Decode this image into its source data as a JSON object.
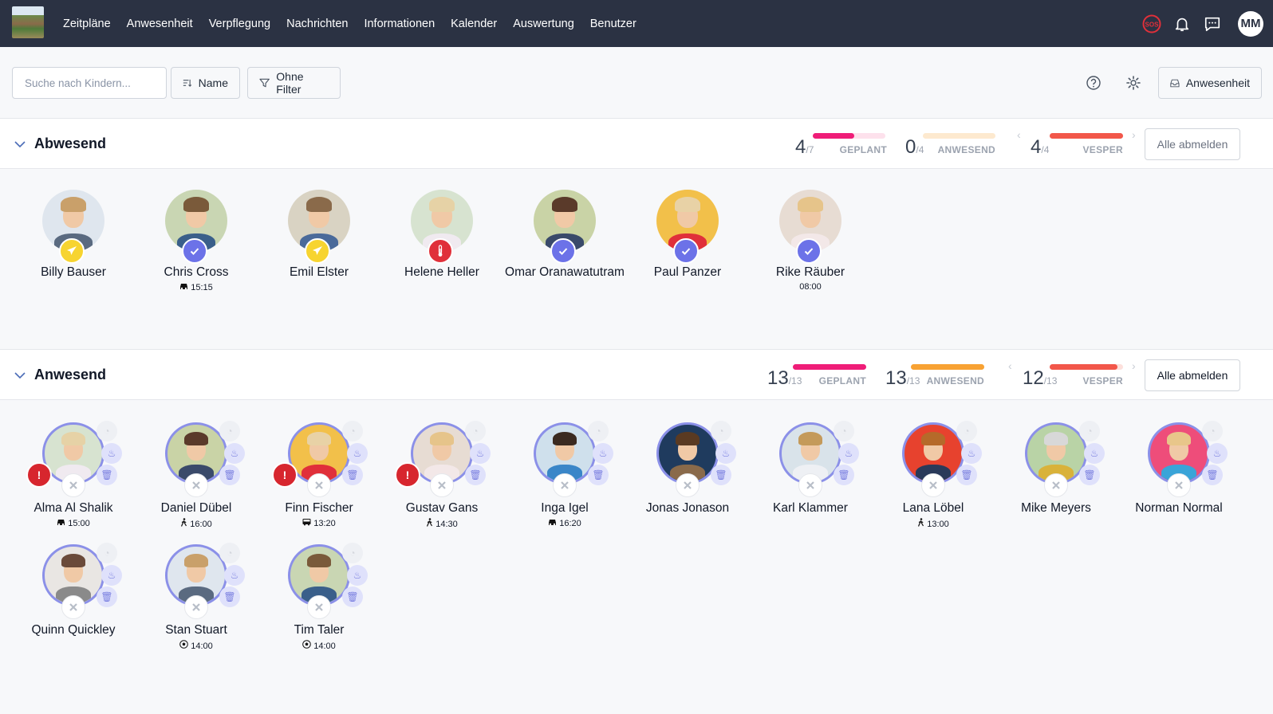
{
  "nav": {
    "items": [
      "Zeitpläne",
      "Anwesenheit",
      "Verpflegung",
      "Nachrichten",
      "Informationen",
      "Kalender",
      "Auswertung",
      "Benutzer"
    ],
    "sos_label": "SOS",
    "user_initials": "MM"
  },
  "toolbar": {
    "search_placeholder": "Suche nach Kindern...",
    "sort_label": "Name",
    "filter_label": "Ohne Filter",
    "attendance_label": "Anwesenheit"
  },
  "sections": [
    {
      "title": "Abwesend",
      "stats": {
        "geplant": {
          "value": "4",
          "total": "/7",
          "label": "GEPLANT",
          "fraction": 0.57,
          "color": "#ef1d78",
          "track": "#fde1ec"
        },
        "anwesend": {
          "value": "0",
          "total": "/4",
          "label": "ANWESEND",
          "fraction": 0,
          "color": "#f8a233",
          "track": "#fde9cf"
        },
        "vesper": {
          "value": "4",
          "total": "/4",
          "label": "VESPER",
          "fraction": 1,
          "color": "#f2574a",
          "track": "#fde0dc"
        }
      },
      "action_label": "Alle abmelden",
      "children": [
        {
          "name": "Billy Bauser",
          "sub": "",
          "status": "vacation"
        },
        {
          "name": "Chris Cross",
          "sub": "15:15",
          "sub_icon": "car",
          "status": "check"
        },
        {
          "name": "Emil Elster",
          "sub": "",
          "status": "vacation"
        },
        {
          "name": "Helene Heller",
          "sub": "",
          "status": "sick"
        },
        {
          "name": "Omar Oranawatutram",
          "sub": "",
          "status": "check"
        },
        {
          "name": "Paul Panzer",
          "sub": "",
          "status": "check"
        },
        {
          "name": "Rike Räuber",
          "sub": "08:00",
          "sub_icon": "",
          "status": "check"
        }
      ]
    },
    {
      "title": "Anwesend",
      "stats": {
        "geplant": {
          "value": "13",
          "total": "/13",
          "label": "GEPLANT",
          "fraction": 1,
          "color": "#ef1d78",
          "track": "#fde1ec"
        },
        "anwesend": {
          "value": "13",
          "total": "/13",
          "label": "ANWESEND",
          "fraction": 1,
          "color": "#f8a233",
          "track": "#fde9cf"
        },
        "vesper": {
          "value": "12",
          "total": "/13",
          "label": "VESPER",
          "fraction": 0.92,
          "color": "#f2574a",
          "track": "#fde0dc"
        }
      },
      "action_label": "Alle abmelden",
      "children": [
        {
          "name": "Alma Al Shalik",
          "sub": "15:00",
          "sub_icon": "car",
          "alert": true
        },
        {
          "name": "Daniel Dübel",
          "sub": "16:00",
          "sub_icon": "walk",
          "alert": false
        },
        {
          "name": "Finn Fischer",
          "sub": "13:20",
          "sub_icon": "bus",
          "alert": true
        },
        {
          "name": "Gustav Gans",
          "sub": "14:30",
          "sub_icon": "walk",
          "alert": true
        },
        {
          "name": "Inga Igel",
          "sub": "16:20",
          "sub_icon": "car",
          "alert": false
        },
        {
          "name": "Jonas Jonason",
          "sub": "",
          "alert": false
        },
        {
          "name": "Karl Klammer",
          "sub": "",
          "alert": false
        },
        {
          "name": "Lana Löbel",
          "sub": "13:00",
          "sub_icon": "walk",
          "alert": false
        },
        {
          "name": "Mike Meyers",
          "sub": "",
          "alert": false
        },
        {
          "name": "Norman Normal",
          "sub": "",
          "alert": false
        },
        {
          "name": "Quinn Quickley",
          "sub": "",
          "alert": false
        },
        {
          "name": "Stan Stuart",
          "sub": "14:00",
          "sub_icon": "ball",
          "alert": false
        },
        {
          "name": "Tim Taler",
          "sub": "14:00",
          "sub_icon": "ball",
          "alert": false
        }
      ]
    }
  ],
  "colors": {
    "nav_bg": "#2b3243",
    "check": "#6c72e8",
    "vacation": "#f7d430",
    "sick": "#e0303a",
    "alert": "#d7262e"
  }
}
